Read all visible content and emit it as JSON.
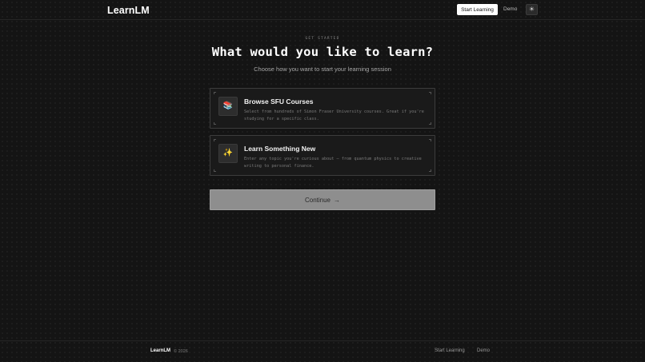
{
  "header": {
    "logo": "LearnLM",
    "nav": {
      "start_learning": "Start Learning",
      "demo": "Demo"
    },
    "theme_icon": "sun-icon",
    "theme_glyph": "☀"
  },
  "hero": {
    "eyebrow": "GET STARTED",
    "title": "What would you like to learn?",
    "subtitle": "Choose how you want to start your learning session"
  },
  "options": [
    {
      "icon": "books-icon",
      "icon_glyph": "📚",
      "title": "Browse SFU Courses",
      "description": "Select from hundreds of Simon Fraser University courses. Great if you're studying for a specific class."
    },
    {
      "icon": "sparkles-icon",
      "icon_glyph": "✨",
      "title": "Learn Something New",
      "description": "Enter any topic you're curious about — from quantum physics to creative writing to personal finance."
    }
  ],
  "continue_button": {
    "label": "Continue",
    "arrow": "→"
  },
  "footer": {
    "logo": "LearnLM",
    "copyright": "© 2026",
    "links": {
      "start_learning": "Start Learning",
      "demo": "Demo"
    }
  }
}
